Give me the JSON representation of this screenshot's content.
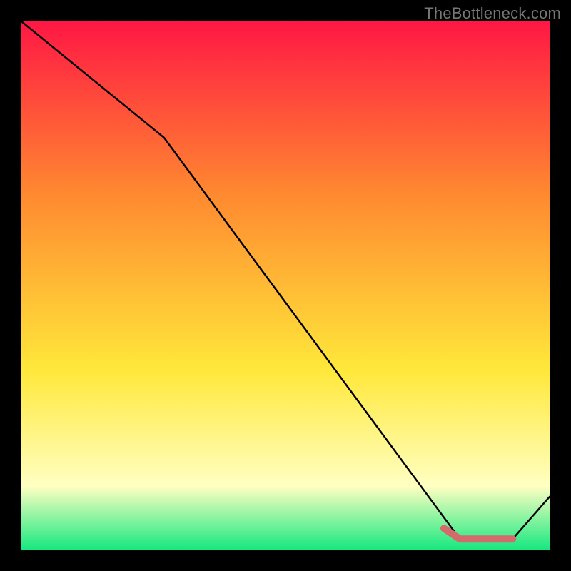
{
  "watermark": "TheBottleneck.com",
  "colors": {
    "background": "#000000",
    "gradient_top": "#ff1744",
    "gradient_mid_upper": "#ff8a30",
    "gradient_mid_lower": "#ffe83a",
    "gradient_pale": "#ffffc2",
    "gradient_bottom": "#17e880",
    "line": "#000000",
    "highlight": "#d36a6c"
  },
  "chart_data": {
    "type": "line",
    "title": "",
    "xlabel": "",
    "ylabel": "",
    "xlim": [
      0,
      100
    ],
    "ylim": [
      0,
      100
    ],
    "series": [
      {
        "name": "curve",
        "x": [
          0,
          27,
          83,
          93,
          100
        ],
        "values": [
          100,
          78,
          2,
          2,
          10
        ]
      }
    ],
    "highlight_segment": {
      "name": "minimum-region",
      "x": [
        80,
        83,
        87,
        90,
        93
      ],
      "values": [
        4,
        2,
        2,
        2,
        2
      ]
    }
  }
}
